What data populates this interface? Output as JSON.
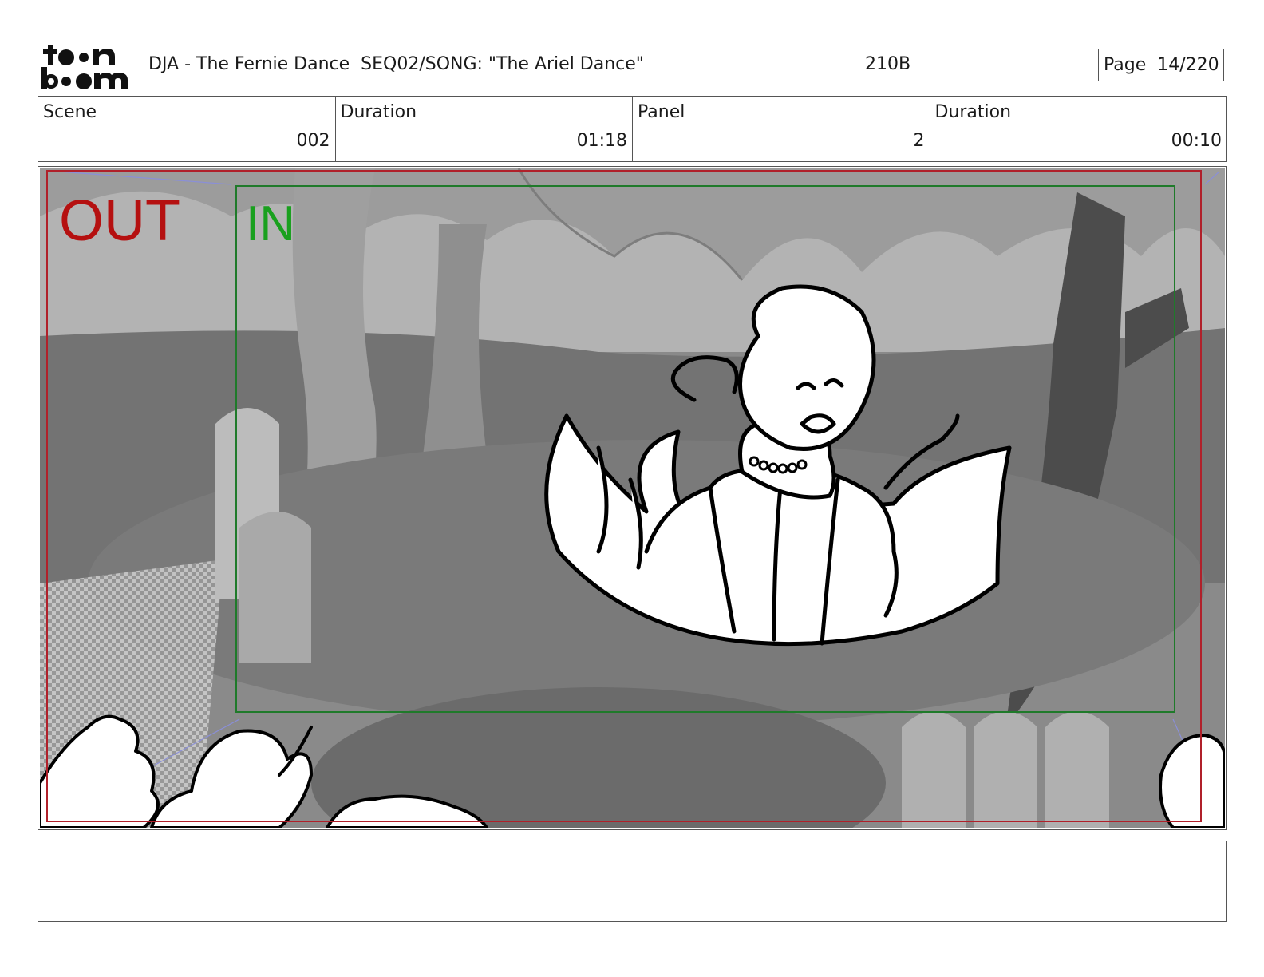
{
  "header": {
    "logo_line1": "t●●n",
    "logo_line2": "b●●m",
    "title": "DJA - The Fernie Dance  SEQ02/SONG: \"The Ariel Dance\"",
    "code": "210B",
    "page_label": "Page  14/220"
  },
  "info": {
    "scene_label": "Scene",
    "scene_value": "002",
    "scene_duration_label": "Duration",
    "scene_duration_value": "01:18",
    "panel_label": "Panel",
    "panel_value": "2",
    "panel_duration_label": "Duration",
    "panel_duration_value": "00:10"
  },
  "panel": {
    "out_label": "OUT",
    "in_label": "IN",
    "colors": {
      "out_frame": "#b0202a",
      "in_frame": "#1f7a2a",
      "out_text": "#b51010",
      "in_text": "#19a01e",
      "camera_lines": "#8a8fd8"
    }
  },
  "caption": {
    "text": ""
  }
}
